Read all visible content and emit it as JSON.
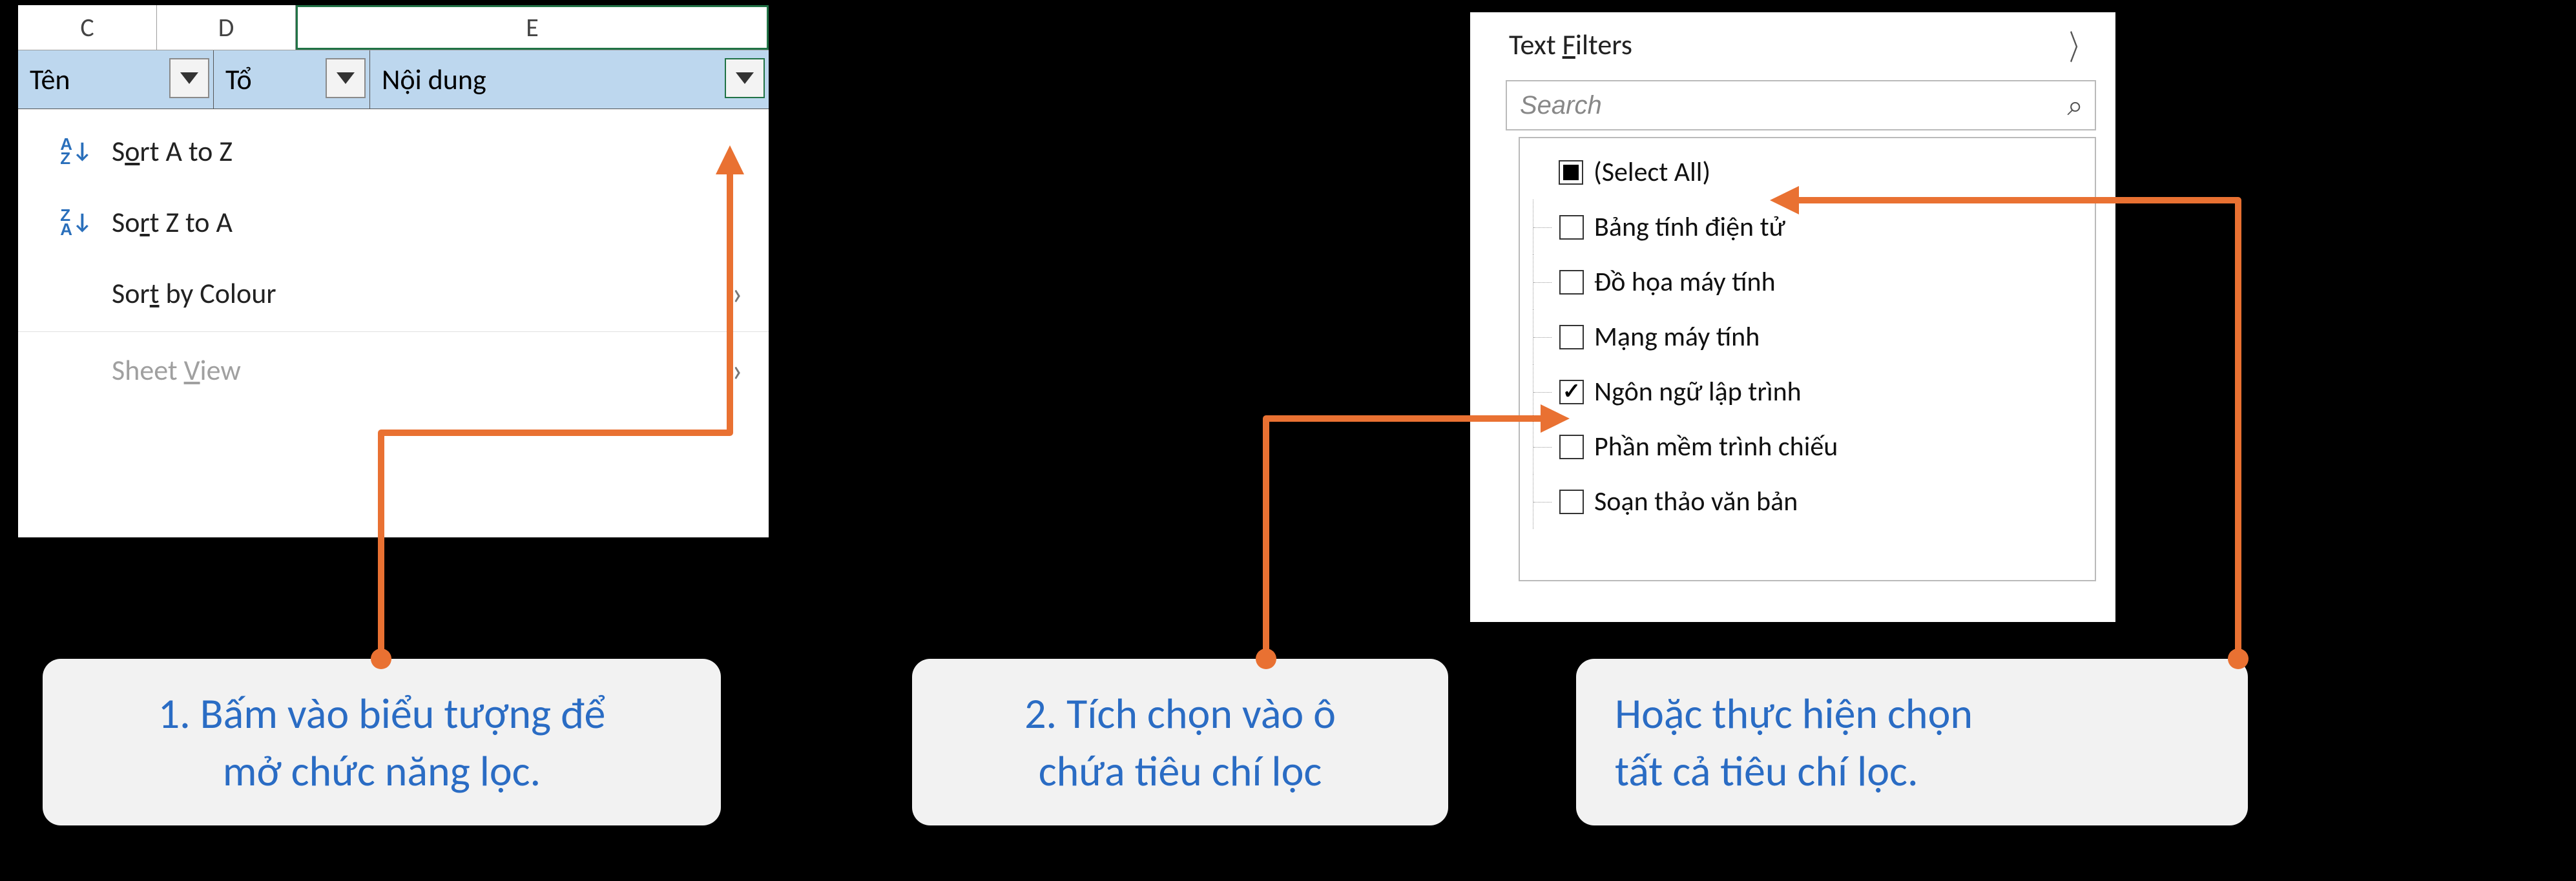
{
  "left": {
    "cols": {
      "c": "C",
      "d": "D",
      "e": "E"
    },
    "headers": {
      "c": "Tên",
      "d": "Tổ",
      "e": "Nội dung"
    },
    "menu": {
      "sort_az": "Sort A to Z",
      "sort_za": "Sort Z to A",
      "sort_colour": "Sort by Colour",
      "sheet_view": "Sheet View"
    }
  },
  "right": {
    "text_filters": "Text Filters",
    "search_placeholder": "Search",
    "items": [
      {
        "label": "(Select All)",
        "state": "mixed"
      },
      {
        "label": "Bảng tính điện tử",
        "state": "unchecked"
      },
      {
        "label": "Đồ họa máy tính",
        "state": "unchecked"
      },
      {
        "label": "Mạng máy tính",
        "state": "unchecked"
      },
      {
        "label": "Ngôn ngữ lập trình",
        "state": "checked"
      },
      {
        "label": "Phần mềm trình chiếu",
        "state": "unchecked"
      },
      {
        "label": "Soạn thảo văn bản",
        "state": "unchecked"
      }
    ]
  },
  "callouts": {
    "c1a": "1. Bấm vào biểu tượng để",
    "c1b": "mở chức năng lọc.",
    "c2a": "2. Tích chọn vào ô",
    "c2b": "chứa tiêu chí lọc",
    "c3a": "Hoặc thực hiện chọn",
    "c3b": "tất cả tiêu chí lọc."
  }
}
